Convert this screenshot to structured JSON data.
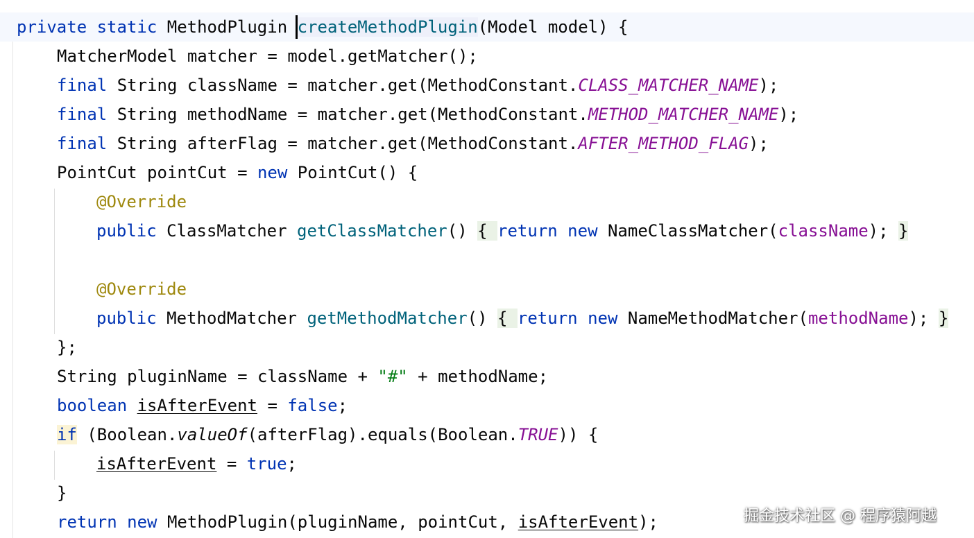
{
  "editor": {
    "language": "Java",
    "colors": {
      "keyword": "#0033b3",
      "method_declaration": "#00627a",
      "field_or_constant": "#871094",
      "annotation": "#9e880d",
      "string": "#067d17",
      "plain": "#080808",
      "current_line": "#f5f8fe",
      "brace_highlight": "#eaf2e6"
    },
    "lines": [
      {
        "tokens": [
          {
            "t": "private",
            "c": "kw"
          },
          {
            "t": " ",
            "c": ""
          },
          {
            "t": "static",
            "c": "kw"
          },
          {
            "t": " MethodPlugin ",
            "c": ""
          },
          {
            "t": "createMethodPlugin",
            "c": "fn hl-method"
          },
          {
            "t": "(Model model) {",
            "c": ""
          }
        ]
      },
      {
        "tokens": [
          {
            "t": "MatcherModel matcher = model.getMatcher();",
            "c": ""
          }
        ]
      },
      {
        "tokens": [
          {
            "t": "final",
            "c": "kw"
          },
          {
            "t": " String className = matcher.get(MethodConstant.",
            "c": ""
          },
          {
            "t": "CLASS_MATCHER_NAME",
            "c": "fld ital"
          },
          {
            "t": ");",
            "c": ""
          }
        ]
      },
      {
        "tokens": [
          {
            "t": "final",
            "c": "kw"
          },
          {
            "t": " String methodName = matcher.get(MethodConstant.",
            "c": ""
          },
          {
            "t": "METHOD_MATCHER_NAME",
            "c": "fld ital"
          },
          {
            "t": ");",
            "c": ""
          }
        ]
      },
      {
        "tokens": [
          {
            "t": "final",
            "c": "kw"
          },
          {
            "t": " String afterFlag = matcher.get(MethodConstant.",
            "c": ""
          },
          {
            "t": "AFTER_METHOD_FLAG",
            "c": "fld ital"
          },
          {
            "t": ");",
            "c": ""
          }
        ]
      },
      {
        "tokens": [
          {
            "t": "PointCut pointCut = ",
            "c": ""
          },
          {
            "t": "new",
            "c": "kw"
          },
          {
            "t": " PointCut() {",
            "c": ""
          }
        ]
      },
      {
        "tokens": [
          {
            "t": "@Override",
            "c": "annot"
          }
        ]
      },
      {
        "tokens": [
          {
            "t": "public",
            "c": "kw"
          },
          {
            "t": " ClassMatcher ",
            "c": ""
          },
          {
            "t": "getClassMatcher",
            "c": "fn"
          },
          {
            "t": "() ",
            "c": ""
          },
          {
            "t": "{ ",
            "c": "hl-green"
          },
          {
            "t": "return",
            "c": "kw"
          },
          {
            "t": " ",
            "c": ""
          },
          {
            "t": "new",
            "c": "kw"
          },
          {
            "t": " NameClassMatcher(",
            "c": ""
          },
          {
            "t": "className",
            "c": "fld"
          },
          {
            "t": "); ",
            "c": ""
          },
          {
            "t": "}",
            "c": "hl-green"
          }
        ]
      },
      {
        "tokens": []
      },
      {
        "tokens": [
          {
            "t": "@Override",
            "c": "annot"
          }
        ]
      },
      {
        "tokens": [
          {
            "t": "public",
            "c": "kw"
          },
          {
            "t": " MethodMatcher ",
            "c": ""
          },
          {
            "t": "getMethodMatcher",
            "c": "fn"
          },
          {
            "t": "() ",
            "c": ""
          },
          {
            "t": "{ ",
            "c": "hl-green"
          },
          {
            "t": "return",
            "c": "kw"
          },
          {
            "t": " ",
            "c": ""
          },
          {
            "t": "new",
            "c": "kw"
          },
          {
            "t": " NameMethodMatcher(",
            "c": ""
          },
          {
            "t": "methodName",
            "c": "fld"
          },
          {
            "t": "); ",
            "c": ""
          },
          {
            "t": "}",
            "c": "hl-green"
          }
        ]
      },
      {
        "tokens": [
          {
            "t": "};",
            "c": ""
          }
        ]
      },
      {
        "tokens": [
          {
            "t": "String pluginName = className + ",
            "c": ""
          },
          {
            "t": "\"#\"",
            "c": "str"
          },
          {
            "t": " + methodName;",
            "c": ""
          }
        ]
      },
      {
        "tokens": [
          {
            "t": "boolean",
            "c": "kw"
          },
          {
            "t": " ",
            "c": ""
          },
          {
            "t": "isAfterEvent",
            "c": "ul"
          },
          {
            "t": " = ",
            "c": ""
          },
          {
            "t": "false",
            "c": "kw"
          },
          {
            "t": ";",
            "c": ""
          }
        ]
      },
      {
        "tokens": [
          {
            "t": "if",
            "c": "kw hl-yellow"
          },
          {
            "t": " (Boolean.",
            "c": ""
          },
          {
            "t": "valueOf",
            "c": "ital"
          },
          {
            "t": "(afterFlag).equals(Boolean.",
            "c": ""
          },
          {
            "t": "TRUE",
            "c": "fld ital"
          },
          {
            "t": ")) {",
            "c": ""
          }
        ]
      },
      {
        "tokens": [
          {
            "t": "isAfterEvent",
            "c": "ul"
          },
          {
            "t": " = ",
            "c": ""
          },
          {
            "t": "true",
            "c": "kw"
          },
          {
            "t": ";",
            "c": ""
          }
        ]
      },
      {
        "tokens": [
          {
            "t": "}",
            "c": ""
          }
        ]
      },
      {
        "tokens": [
          {
            "t": "return",
            "c": "kw"
          },
          {
            "t": " ",
            "c": ""
          },
          {
            "t": "new",
            "c": "kw"
          },
          {
            "t": " MethodPlugin(pluginName, pointCut, ",
            "c": ""
          },
          {
            "t": "isAfterEvent",
            "c": "ul"
          },
          {
            "t": ");",
            "c": ""
          }
        ]
      }
    ]
  },
  "watermark": {
    "text": "掘金技术社区 @ 程序猿阿越"
  }
}
